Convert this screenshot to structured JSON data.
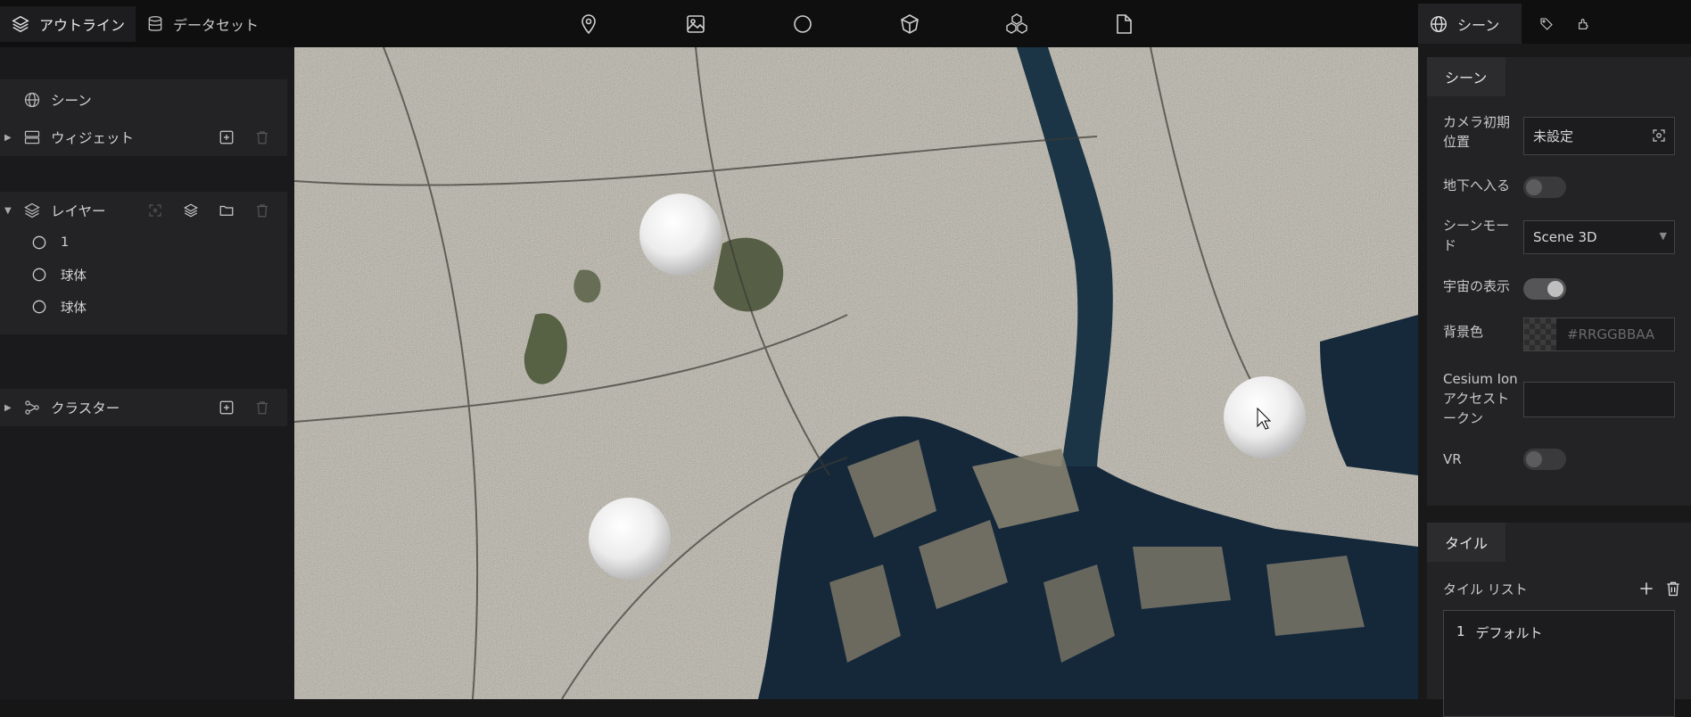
{
  "left_tabs": [
    {
      "label": "アウトライン",
      "icon": "layers-icon",
      "active": true
    },
    {
      "label": "データセット",
      "icon": "database-icon",
      "active": false
    }
  ],
  "toolbar": {
    "tools": [
      "map-pin-icon",
      "image-icon",
      "circle-icon",
      "cube-icon",
      "cubes-icon",
      "file-icon"
    ]
  },
  "outline": {
    "scene_label": "シーン",
    "widget_label": "ウィジェット",
    "layer_label": "レイヤー",
    "layers": [
      {
        "label": "1"
      },
      {
        "label": "球体"
      },
      {
        "label": "球体"
      }
    ],
    "cluster_label": "クラスター"
  },
  "right_tabs": [
    {
      "label": "シーン",
      "icon": "globe-icon",
      "active": true
    },
    {
      "label": "",
      "icon": "tag-icon",
      "active": false
    },
    {
      "label": "",
      "icon": "plugin-icon",
      "active": false
    }
  ],
  "scene_section": {
    "title": "シーン",
    "camera_label_line1": "カメラ初期",
    "camera_label_line2": "位置",
    "camera_value": "未設定",
    "underground_label": "地下へ入る",
    "underground_on": false,
    "scene_mode_label_line1": "シーンモー",
    "scene_mode_label_line2": "ド",
    "scene_mode_value": "Scene 3D",
    "space_label": "宇宙の表示",
    "space_on": true,
    "bgcolor_label": "背景色",
    "bgcolor_placeholder": "#RRGGBBAA",
    "cesium_label_line1": "Cesium Ion",
    "cesium_label_line2": "アクセスト",
    "cesium_label_line3": "ークン",
    "cesium_value": "",
    "vr_label": "VR",
    "vr_on": false
  },
  "tile_section": {
    "title": "タイル",
    "list_label": "タイル リスト",
    "tiles": [
      {
        "index": "1",
        "name": "デフォルト"
      }
    ]
  },
  "colors": {
    "water": "#14283a",
    "land": "#6b6656",
    "panel": "#232325",
    "sphere": "#f2f2f2"
  }
}
